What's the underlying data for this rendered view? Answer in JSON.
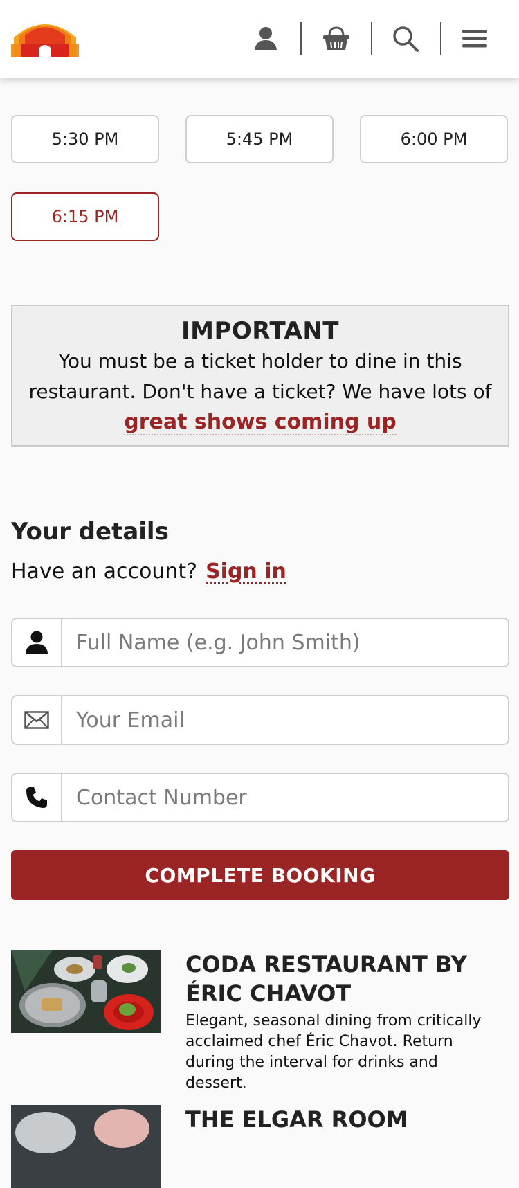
{
  "header": {
    "logo_alt": "Royal Albert Hall",
    "icons": [
      "account-icon",
      "basket-icon",
      "search-icon",
      "menu-icon"
    ]
  },
  "time_slots": [
    {
      "label": "5:30 PM",
      "selected": false
    },
    {
      "label": "5:45 PM",
      "selected": false
    },
    {
      "label": "6:00 PM",
      "selected": false
    },
    {
      "label": "6:15 PM",
      "selected": true
    }
  ],
  "notice": {
    "title": "IMPORTANT",
    "text_line1": "You must be a ticket holder to dine in this",
    "text_line2": "restaurant. Don't have a ticket? We have lots of",
    "link": "great shows coming up"
  },
  "details": {
    "heading": "Your details",
    "account_prompt": "Have an account?",
    "sign_in": "Sign in"
  },
  "form": {
    "name_placeholder": "Full Name (e.g. John Smith)",
    "email_placeholder": "Your Email",
    "phone_placeholder": "Contact Number",
    "submit_label": "COMPLETE BOOKING"
  },
  "restaurants": [
    {
      "title": "CODA RESTAURANT BY ÉRIC CHAVOT",
      "description": "Elegant, seasonal dining from critically acclaimed chef Éric Chavot. Return during the interval for drinks and dessert."
    },
    {
      "title": "THE ELGAR ROOM",
      "description": ""
    }
  ],
  "colors": {
    "accent": "#9b2425",
    "logo_red": "#d9251c",
    "logo_orange": "#f39b1a"
  }
}
